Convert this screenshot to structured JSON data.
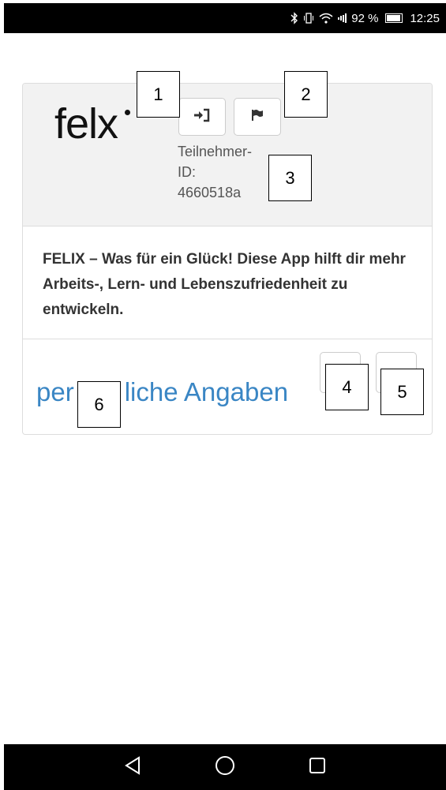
{
  "status_bar": {
    "icons": [
      "bluetooth-icon",
      "vibrate-icon",
      "wifi-icon",
      "signal-icon",
      "battery-icon"
    ],
    "battery_percent": "92 %",
    "time": "12:25"
  },
  "header": {
    "logo_text": "felx",
    "login_button_icon": "login-icon",
    "flag_button_icon": "flag-icon",
    "participant_label_line1": "Teilnehmer-",
    "participant_label_line2": "ID:",
    "participant_id": "4660518a"
  },
  "intro": {
    "text": "FELIX – Was für ein Glück! Diese App hilft dir mehr Arbeits-, Lern- und Lebenszufriedenheit zu entwickeln."
  },
  "section": {
    "title_part1": "per",
    "title_part2": "liche Angaben"
  },
  "callouts": [
    "1",
    "2",
    "3",
    "4",
    "5",
    "6"
  ],
  "nav": {
    "icons": [
      "back-icon",
      "home-icon",
      "recents-icon"
    ]
  },
  "colors": {
    "accent": "#3a86c4",
    "header_bg": "#f2f2f2",
    "bar_bg": "#000000"
  }
}
